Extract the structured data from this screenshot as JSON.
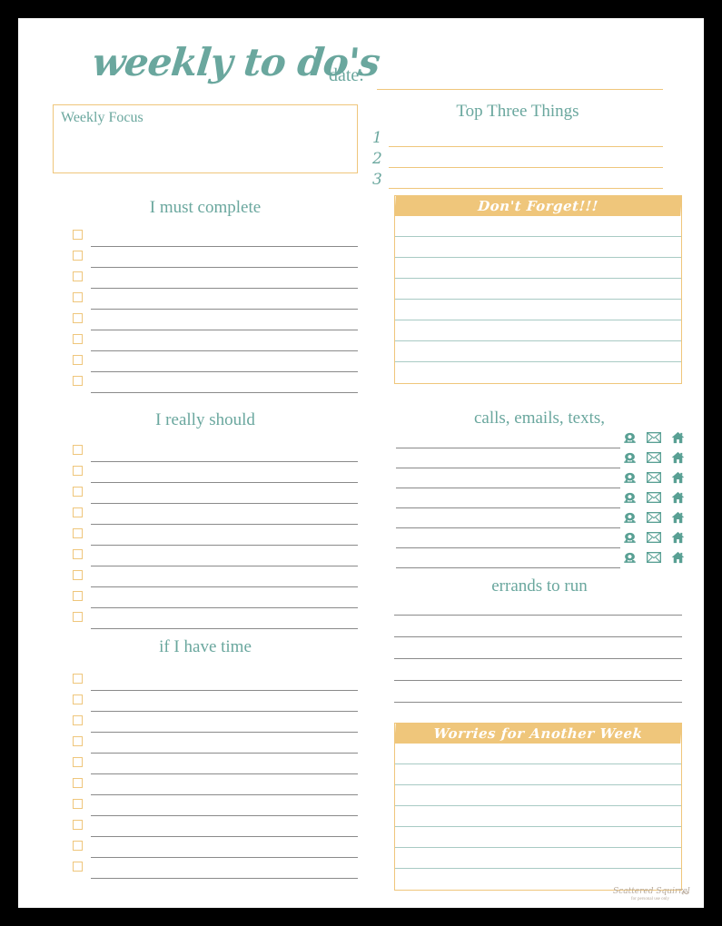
{
  "header": {
    "title": "weekly to do's",
    "date_label": "date:",
    "date_value": ""
  },
  "weekly_focus": {
    "label": "Weekly Focus",
    "value": ""
  },
  "top_three": {
    "title": "Top Three Things",
    "rows": [
      {
        "number": "1",
        "value": ""
      },
      {
        "number": "2",
        "value": ""
      },
      {
        "number": "3",
        "value": ""
      }
    ]
  },
  "must_complete": {
    "title": "I must complete",
    "items": [
      "",
      "",
      "",
      "",
      "",
      "",
      "",
      ""
    ]
  },
  "really_should": {
    "title": "I really should",
    "items": [
      "",
      "",
      "",
      "",
      "",
      "",
      "",
      "",
      ""
    ]
  },
  "if_i_have_time": {
    "title": "if I have time",
    "items": [
      "",
      "",
      "",
      "",
      "",
      "",
      "",
      "",
      "",
      ""
    ]
  },
  "dont_forget": {
    "title": "Don't Forget!!!",
    "rows": [
      "",
      "",
      "",
      "",
      "",
      "",
      "",
      ""
    ]
  },
  "contacts": {
    "title": "calls, emails, texts,",
    "icons": [
      "phone-icon",
      "envelope-icon",
      "house-icon"
    ],
    "rows": [
      "",
      "",
      "",
      "",
      "",
      "",
      ""
    ]
  },
  "errands": {
    "title": "errands to run",
    "rows": [
      "",
      "",
      "",
      "",
      "",
      ""
    ]
  },
  "worries": {
    "title": "Worries for Another Week",
    "rows": [
      "",
      "",
      "",
      "",
      "",
      "",
      ""
    ]
  },
  "footer": {
    "brand": "Scattered Squirrel",
    "note": "for personal use only"
  },
  "colors": {
    "teal": "#6aa79e",
    "teal_light": "#a8cac4",
    "orange": "#efc67b",
    "line_gray": "#8a8a8a",
    "page": "#ffffff",
    "backdrop": "#000000"
  }
}
